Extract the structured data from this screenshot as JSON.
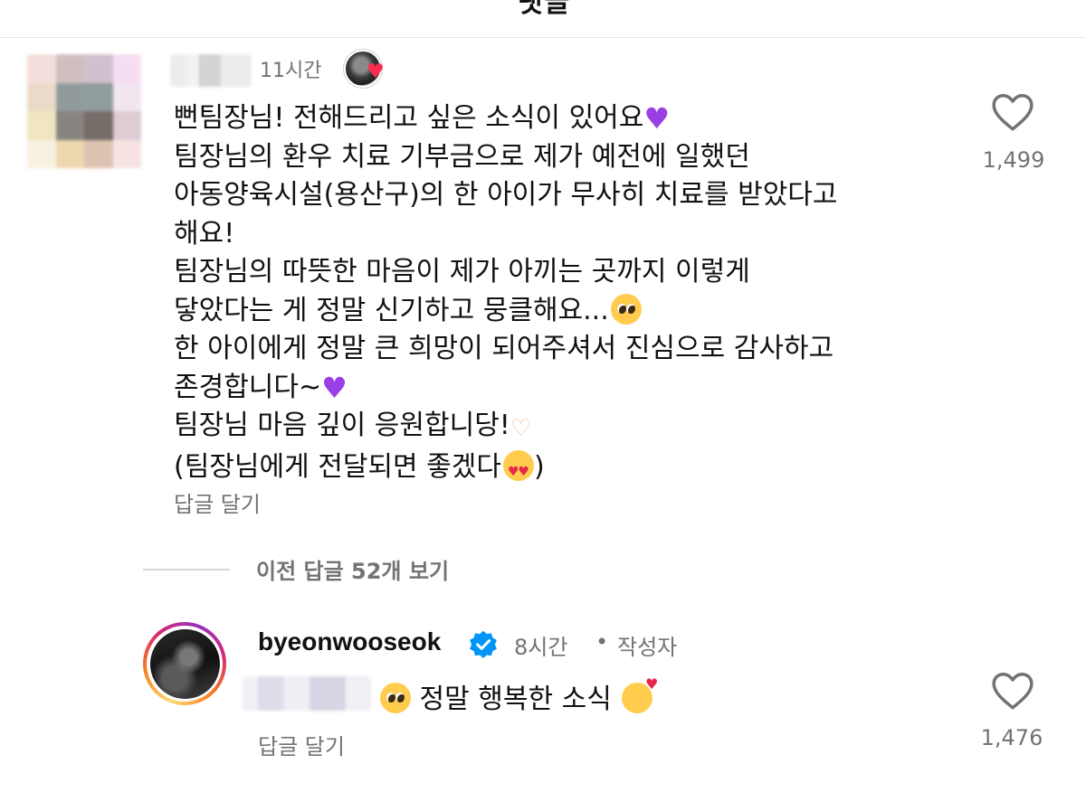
{
  "header": {
    "title": "댓글"
  },
  "comment": {
    "time": "11시간",
    "lines": [
      "뻔팀장님! 전해드리고 싶은 소식이 있어요",
      "팀장님의 환우 치료 기부금으로 제가 예전에 일했던",
      "아동양육시설(용산구)의 한 아이가 무사히 치료를 받았다고",
      "해요!",
      "팀장님의 따뜻한 마음이 제가 아끼는 곳까지 이렇게",
      "닿았다는 게 정말 신기하고 뭉클해요...",
      "한 아이에게 정말 큰 희망이 되어주셔서 진심으로 감사하고",
      "존경합니다~",
      "팀장님 마음 깊이 응원합니당!",
      "(팀장님에게 전달되면 좋겠다",
      ")"
    ],
    "reply_label": "답글 달기",
    "like_count": "1,499",
    "icons": {
      "purple_heart": "purple-heart-emoji",
      "pleading_face": "pleading-face-emoji",
      "heart_hands": "heart-hands-emoji",
      "heart_eyes": "heart-eyes-emoji",
      "like": "heart-outline-icon",
      "liked_by_creator": "creator-heart-avatar"
    }
  },
  "view_replies": {
    "label": "이전 답글 52개 보기"
  },
  "reply": {
    "username": "byeonwooseok",
    "time": "8시간",
    "separator": "•",
    "author_label": "작성자",
    "text": "정말 행복한 소식",
    "reply_label": "답글 달기",
    "like_count": "1,476",
    "icons": {
      "verified": "verified-badge-icon",
      "pleading_face": "pleading-face-emoji",
      "smiling_hearts": "smiling-face-with-hearts-emoji",
      "like": "heart-outline-icon"
    }
  },
  "colors": {
    "text_primary": "#111111",
    "text_secondary": "#737373",
    "verified_blue": "#0095f6",
    "purple_heart": "#9a3fe6",
    "like_red": "#ff2d4f"
  }
}
